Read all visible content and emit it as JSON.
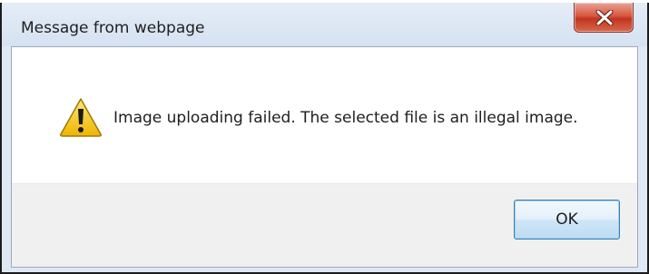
{
  "window": {
    "title": "Message from webpage",
    "close_icon": "close-icon"
  },
  "dialog": {
    "icon": "warning-icon",
    "message": "Image uploading failed. The selected file is an illegal image.",
    "ok_label": "OK"
  },
  "colors": {
    "close_button": "#c94a32",
    "ok_border": "#3c7fb1",
    "warning_fill": "#f5c400"
  }
}
